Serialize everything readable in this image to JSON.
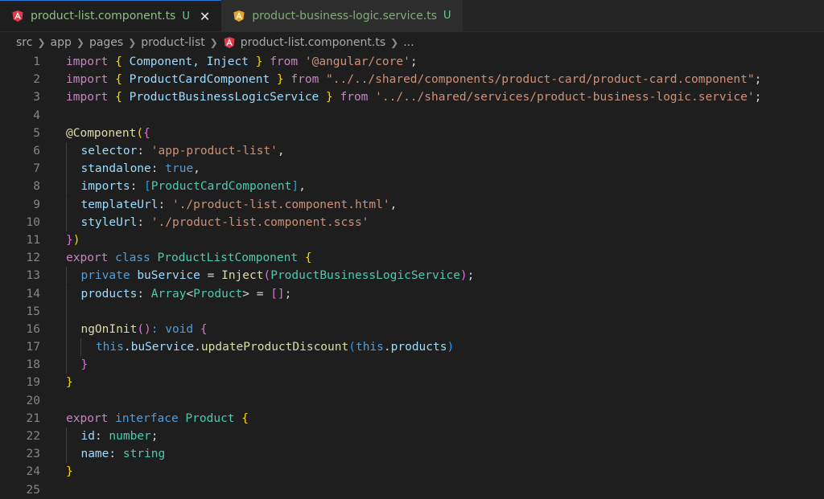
{
  "tabs": [
    {
      "label": "product-list.component.ts",
      "status": "U",
      "active": true,
      "icon": "angular-icon-red"
    },
    {
      "label": "product-business-logic.service.ts",
      "status": "U",
      "active": false,
      "icon": "angular-icon-orange"
    }
  ],
  "breadcrumb": [
    "src",
    "app",
    "pages",
    "product-list",
    "product-list.component.ts",
    "..."
  ],
  "colors": {
    "keyword": "#569cd6",
    "import": "#c586c0",
    "string": "#ce9178",
    "class": "#4ec9b0",
    "variable": "#9cdcfe",
    "function": "#dcdcaa",
    "bracket1": "#ffd700",
    "bracket2": "#da70d6",
    "bracket3": "#179fff"
  },
  "lines": [
    {
      "n": "1"
    },
    {
      "n": "2"
    },
    {
      "n": "3"
    },
    {
      "n": "4"
    },
    {
      "n": "5"
    },
    {
      "n": "6"
    },
    {
      "n": "7"
    },
    {
      "n": "8"
    },
    {
      "n": "9"
    },
    {
      "n": "10"
    },
    {
      "n": "11"
    },
    {
      "n": "12"
    },
    {
      "n": "13"
    },
    {
      "n": "14"
    },
    {
      "n": "15"
    },
    {
      "n": "16"
    },
    {
      "n": "17"
    },
    {
      "n": "18"
    },
    {
      "n": "19"
    },
    {
      "n": "20"
    },
    {
      "n": "21"
    },
    {
      "n": "22"
    },
    {
      "n": "23"
    },
    {
      "n": "24"
    },
    {
      "n": "25"
    }
  ],
  "code": {
    "l1": [
      "import",
      " ",
      "{",
      " Component, Inject ",
      "}",
      " from ",
      "'@angular/core'",
      ";"
    ],
    "l2": [
      "import",
      " ",
      "{",
      " ProductCardComponent ",
      "}",
      " from ",
      "\"../../shared/components/product-card/product-card.component\"",
      ";"
    ],
    "l3": [
      "import",
      " ",
      "{",
      " ProductBusinessLogicService ",
      "}",
      " from ",
      "'../../shared/services/product-business-logic.service'",
      ";"
    ],
    "l5": [
      "@",
      "Component",
      "(",
      "{"
    ],
    "l6": [
      "selector",
      ": ",
      "'app-product-list'",
      ","
    ],
    "l7": [
      "standalone",
      ": ",
      "true",
      ","
    ],
    "l8": [
      "imports",
      ": ",
      "[",
      "ProductCardComponent",
      "]",
      ","
    ],
    "l9": [
      "templateUrl",
      ": ",
      "'./product-list.component.html'",
      ","
    ],
    "l10": [
      "styleUrl",
      ": ",
      "'./product-list.component.scss'"
    ],
    "l11": [
      "}",
      ")"
    ],
    "l12": [
      "export",
      " class ",
      "ProductListComponent",
      " ",
      "{"
    ],
    "l13": [
      "private",
      " ",
      "buService",
      " = ",
      "Inject",
      "(",
      "ProductBusinessLogicService",
      ")",
      ";"
    ],
    "l14": [
      "products",
      ": ",
      "Array",
      "<",
      "Product",
      "> = ",
      "[]",
      ";"
    ],
    "l16": [
      "ngOnInit",
      "()",
      ": void ",
      "{"
    ],
    "l17": [
      "this",
      ".",
      "buService",
      ".",
      "updateProductDiscount",
      "(",
      "this",
      ".",
      "products",
      ")"
    ],
    "l18": [
      "}"
    ],
    "l19": [
      "}"
    ],
    "l21": [
      "export",
      " interface ",
      "Product",
      " ",
      "{"
    ],
    "l22": [
      "id",
      ": ",
      "number",
      ";"
    ],
    "l23": [
      "name",
      ": ",
      "string"
    ],
    "l24": [
      "}"
    ]
  }
}
